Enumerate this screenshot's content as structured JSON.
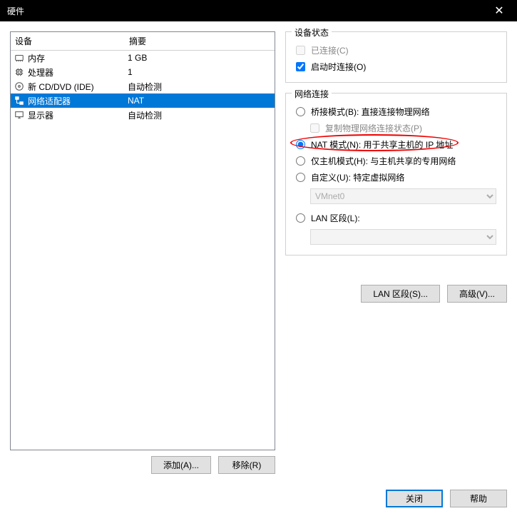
{
  "title": "硬件",
  "columns": {
    "device": "设备",
    "summary": "摘要"
  },
  "devices": [
    {
      "name": "内存",
      "summary": "1 GB",
      "icon": "memory"
    },
    {
      "name": "处理器",
      "summary": "1",
      "icon": "cpu"
    },
    {
      "name": "新 CD/DVD (IDE)",
      "summary": "自动检测",
      "icon": "disc"
    },
    {
      "name": "网络适配器",
      "summary": "NAT",
      "icon": "network",
      "selected": true
    },
    {
      "name": "显示器",
      "summary": "自动检测",
      "icon": "monitor"
    }
  ],
  "buttons": {
    "add": "添加(A)...",
    "remove": "移除(R)",
    "lanSegment": "LAN 区段(S)...",
    "advanced": "高级(V)...",
    "close": "关闭",
    "help": "帮助"
  },
  "status": {
    "title": "设备状态",
    "connected": "已连接(C)",
    "connectAtPowerOn": "启动时连接(O)"
  },
  "network": {
    "title": "网络连接",
    "bridged": "桥接模式(B): 直接连接物理网络",
    "replicate": "复制物理网络连接状态(P)",
    "nat": "NAT 模式(N): 用于共享主机的 IP 地址",
    "hostOnly": "仅主机模式(H): 与主机共享的专用网络",
    "custom": "自定义(U): 特定虚拟网络",
    "customSelect": "VMnet0",
    "lanSegment": "LAN 区段(L):"
  }
}
